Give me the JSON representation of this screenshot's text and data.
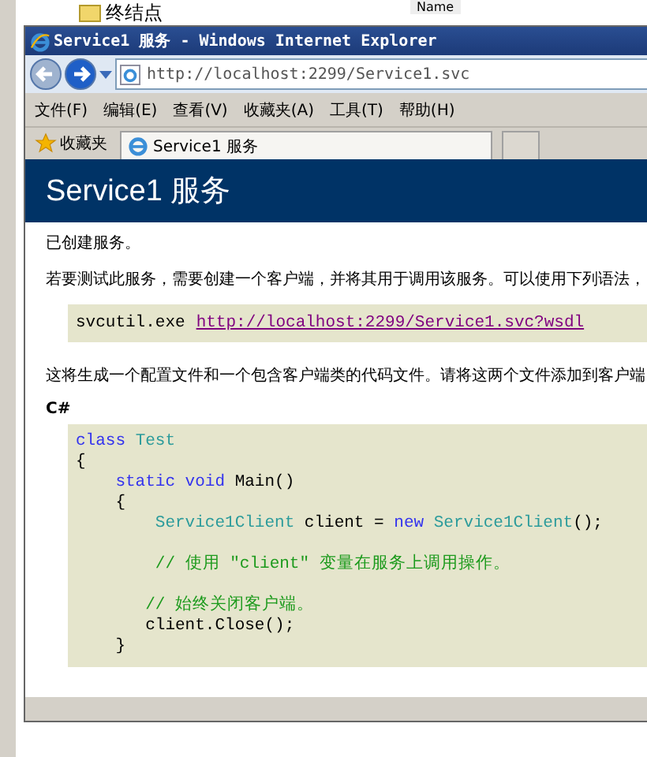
{
  "background": {
    "tree_item": "终结点",
    "column_header": "Name"
  },
  "browser": {
    "title": "Service1 服务 - Windows Internet Explorer",
    "address": "http://localhost:2299/Service1.svc",
    "menu": [
      "文件(F)",
      "编辑(E)",
      "查看(V)",
      "收藏夹(A)",
      "工具(T)",
      "帮助(H)"
    ],
    "favorites": "收藏夹",
    "tabs": [
      {
        "label": "Service1 服务",
        "selected": true
      }
    ]
  },
  "page": {
    "heading": "Service1 服务",
    "created": "已创建服务。",
    "intro": "若要测试此服务，需要创建一个客户端，并将其用于调用该服务。可以使用下列语法，",
    "command": "svcutil.exe",
    "wsdl_link": "http://localhost:2299/Service1.svc?wsdl",
    "generates": "这将生成一个配置文件和一个包含客户端类的代码文件。请将这两个文件添加到客户端",
    "language": "C#",
    "code": [
      {
        "kind": "code",
        "tokens": [
          {
            "text": "class ",
            "kind": "keyword"
          },
          {
            "text": "Test",
            "kind": "type"
          }
        ]
      },
      {
        "kind": "code",
        "tokens": [
          {
            "text": "{",
            "kind": "plain"
          }
        ]
      },
      {
        "kind": "code",
        "tokens": [
          {
            "text": "    static void",
            "kind": "keyword"
          },
          {
            "text": " Main()",
            "kind": "plain"
          }
        ]
      },
      {
        "kind": "code",
        "tokens": [
          {
            "text": "    {",
            "kind": "plain"
          }
        ]
      },
      {
        "kind": "code",
        "tokens": [
          {
            "text": "        Service1Client",
            "kind": "type"
          },
          {
            "text": " client = ",
            "kind": "plain"
          },
          {
            "text": "new ",
            "kind": "keyword"
          },
          {
            "text": "Service1Client",
            "kind": "type"
          },
          {
            "text": "();",
            "kind": "plain"
          }
        ]
      },
      {
        "kind": "blank"
      },
      {
        "kind": "code",
        "tokens": [
          {
            "text": "        // 使用 \"client\" 变量在服务上调用操作。",
            "kind": "comment"
          }
        ]
      },
      {
        "kind": "blank"
      },
      {
        "kind": "code",
        "tokens": [
          {
            "text": "       // 始终关闭客户端。",
            "kind": "comment"
          }
        ]
      },
      {
        "kind": "code",
        "tokens": [
          {
            "text": "       client.Close();",
            "kind": "plain"
          }
        ]
      },
      {
        "kind": "code",
        "tokens": [
          {
            "text": "    }",
            "kind": "plain"
          }
        ]
      }
    ]
  }
}
